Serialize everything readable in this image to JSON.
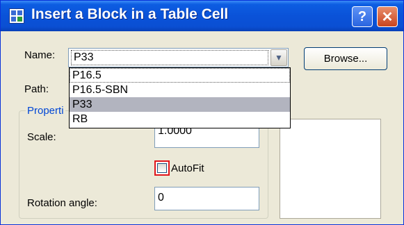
{
  "titlebar": {
    "title": "Insert a Block in a Table Cell",
    "help_label": "?",
    "close_label": "✕"
  },
  "name_field": {
    "label": "Name:",
    "value": "P33",
    "browse_label": "Browse..."
  },
  "path_field": {
    "label": "Path:"
  },
  "dropdown": {
    "options": [
      "P16.5",
      "P16.5-SBN",
      "P33",
      "RB"
    ],
    "selected": "P33"
  },
  "properties": {
    "group_label": "Properti",
    "scale_label": "Scale:",
    "scale_value": "1.0000",
    "autofit_label": "AutoFit",
    "autofit_checked": false,
    "rotation_label": "Rotation angle:",
    "rotation_value": "0"
  }
}
